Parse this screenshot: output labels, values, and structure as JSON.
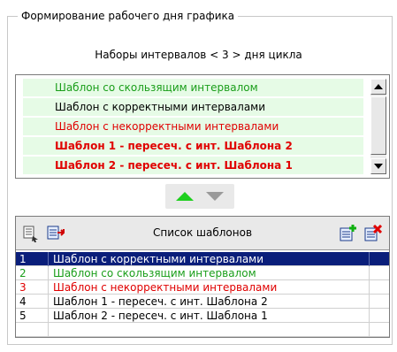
{
  "group": {
    "title": "Формирование рабочего дня графика"
  },
  "subtitle": "Наборы интервалов < 3 > дня цикла",
  "top_list": {
    "items": [
      {
        "label": "Шаблон со скользящим интервалом",
        "color": "#1a9e1a",
        "bold": false
      },
      {
        "label": "Шаблон с корректными интервалами",
        "color": "#000000",
        "bold": false
      },
      {
        "label": "Шаблон с некорректными интервалами",
        "color": "#e00000",
        "bold": false
      },
      {
        "label": "Шаблон 1 - пересеч. с  инт. Шаблона 2",
        "color": "#e00000",
        "bold": true
      },
      {
        "label": "Шаблон 2 - пересеч. с  инт. Шаблона 1",
        "color": "#e00000",
        "bold": true
      }
    ],
    "row_background": "#e6fbe6"
  },
  "move_buttons": {
    "up_icon": "arrow-up-icon",
    "down_icon": "arrow-down-icon",
    "up_color": "#1ecf1e",
    "down_color": "#9a9a9a"
  },
  "templates_grid": {
    "header_title": "Список шаблонов",
    "icons": [
      "select-icon",
      "copy-template-icon",
      "add-template-icon",
      "delete-template-icon"
    ],
    "rows": [
      {
        "num": "1",
        "name": "Шаблон с корректными интервалами",
        "color": "#ffffff",
        "selected": true
      },
      {
        "num": "2",
        "name": "Шаблон со скользящим интервалом",
        "color": "#1a9e1a",
        "selected": false
      },
      {
        "num": "3",
        "name": "Шаблон с некорректными интервалами",
        "color": "#e00000",
        "selected": false
      },
      {
        "num": "4",
        "name": "Шаблон 1 - пересеч. с  инт. Шаблона 2",
        "color": "#000000",
        "selected": false
      },
      {
        "num": "5",
        "name": "Шаблон 2 - пересеч. с  инт. Шаблона 1",
        "color": "#000000",
        "selected": false
      }
    ],
    "selection_color": "#0a1e7a"
  }
}
